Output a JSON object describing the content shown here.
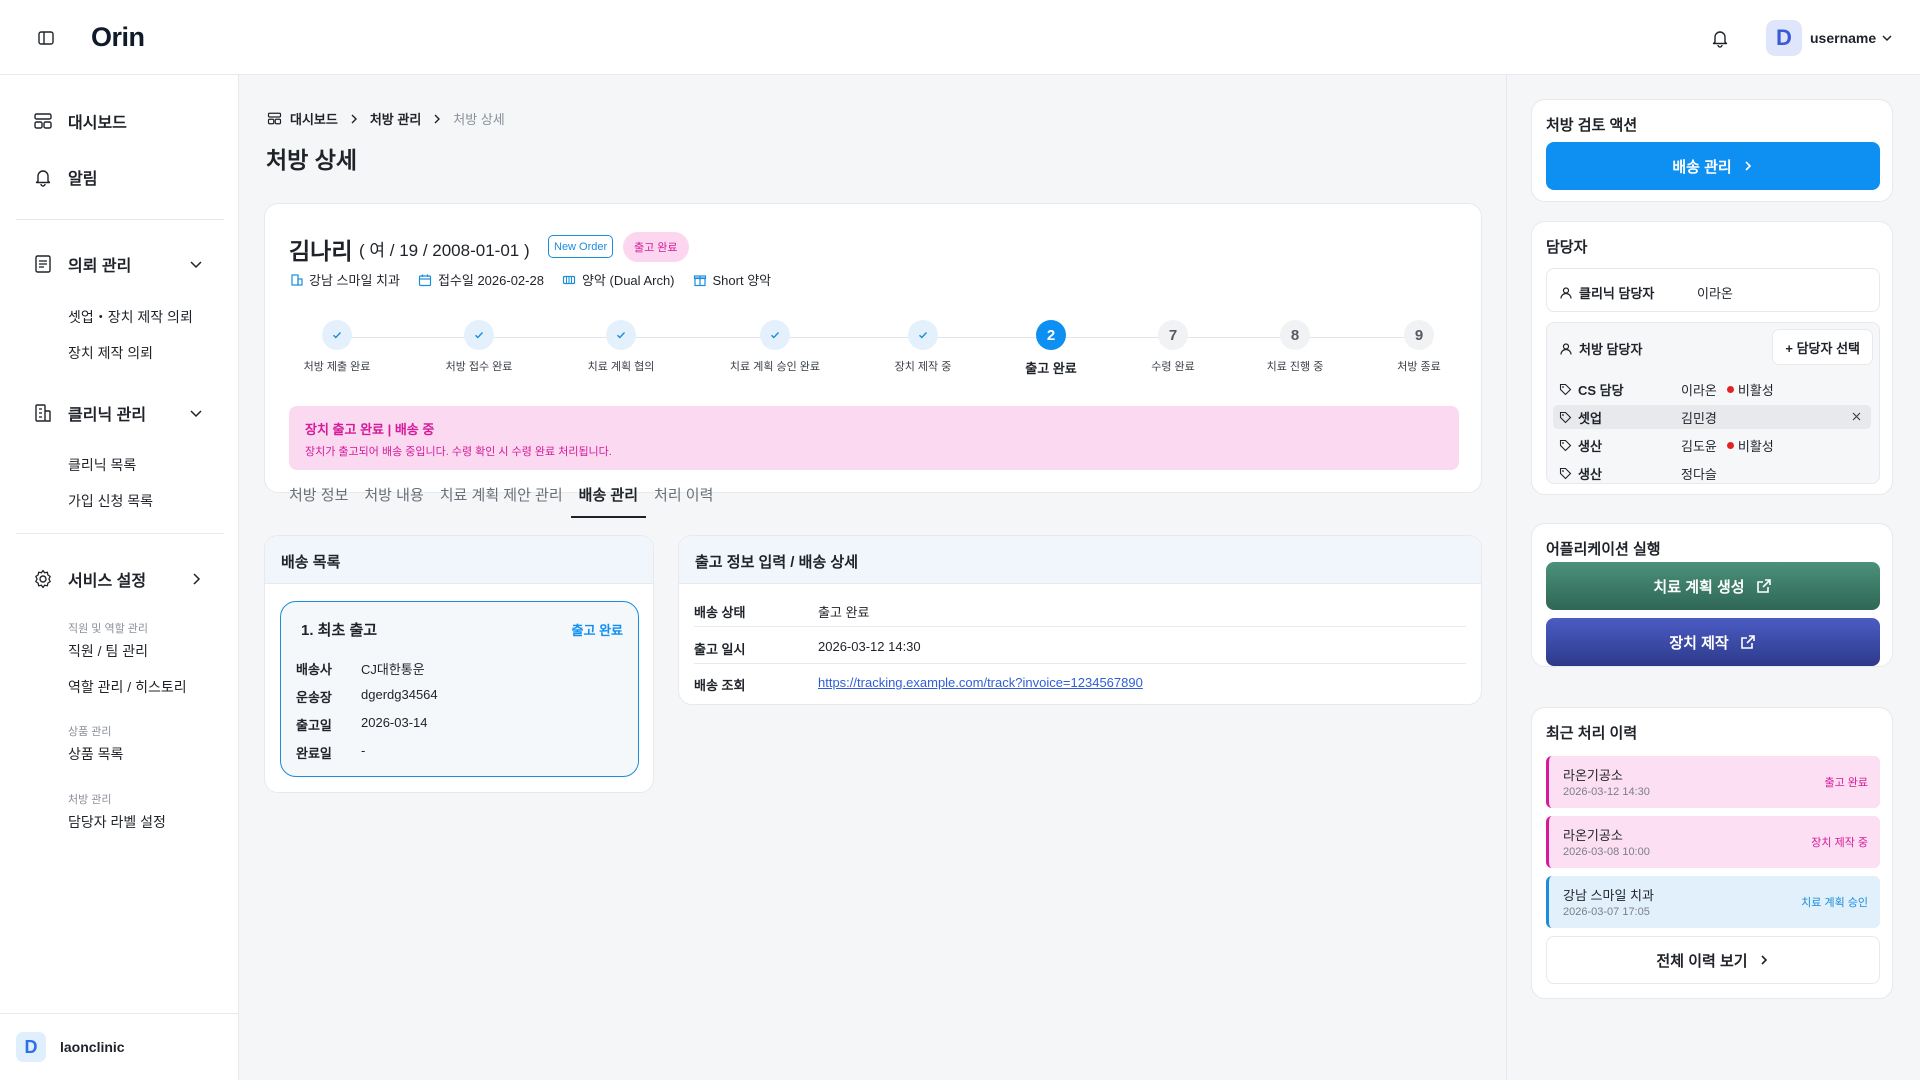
{
  "app": {
    "logo": "Orin",
    "username": "username",
    "avatar_letter": "D"
  },
  "sidebar": {
    "top_items": [
      {
        "label": "대시보드",
        "icon": "dashboard-icon"
      },
      {
        "label": "알림",
        "icon": "bell-icon"
      }
    ],
    "groups": [
      {
        "label": "의뢰 관리",
        "items": [
          "셋업・장치 제작 의뢰",
          "장치 제작 의뢰"
        ]
      },
      {
        "label": "클리닉 관리",
        "items": [
          "클리닉 목록",
          "가입 신청 목록"
        ]
      },
      {
        "label": "서비스 설정",
        "captions": [
          "직원 및 역할 관리",
          "상품 관리",
          "처방 관리"
        ],
        "items": [
          "직원 / 팀 관리",
          "역할 관리 / 히스토리",
          "상품 목록",
          "담당자 라벨 설정"
        ]
      }
    ],
    "footer": {
      "letter": "D",
      "name": "laonclinic"
    }
  },
  "breadcrumb": [
    "대시보드",
    "처방 관리",
    "처방 상세"
  ],
  "page_title": "처방 상세",
  "patient": {
    "name": "김나리",
    "info": "( 여 / 19 / 2008-01-01 )",
    "badge_new": "New Order",
    "badge_status": "출고 완료",
    "clinic": "강남 스마일 치과",
    "received": "접수일 2026-02-28",
    "arch": "양악 (Dual Arch)",
    "plan": "Short 양악"
  },
  "steps": [
    {
      "label": "처방 제출 완료",
      "state": "done"
    },
    {
      "label": "처방 접수 완료",
      "state": "done"
    },
    {
      "label": "치료 계획 협의",
      "state": "done"
    },
    {
      "label": "치료 계획 승인 완료",
      "state": "done"
    },
    {
      "label": "장치 제작 중",
      "state": "done"
    },
    {
      "label": "출고 완료",
      "state": "current",
      "num": "2"
    },
    {
      "label": "수령 완료",
      "state": "todo",
      "num": "7"
    },
    {
      "label": "치료 진행 중",
      "state": "todo",
      "num": "8"
    },
    {
      "label": "처방 종료",
      "state": "todo",
      "num": "9"
    }
  ],
  "alert": {
    "title": "장치 출고 완료 | 배송 중",
    "desc": "장치가 출고되어 배송 중입니다. 수령 확인 시 수령 완료 처리됩니다."
  },
  "tabs": [
    "처방 정보",
    "처방 내용",
    "치료 계획 제안 관리",
    "배송 관리",
    "처리 이력"
  ],
  "active_tab": "배송 관리",
  "shipping_list": {
    "title": "배송 목록",
    "item": {
      "title": "1. 최초 출고",
      "status": "출고 완료",
      "rows": [
        {
          "k": "배송사",
          "v": "CJ대한통운"
        },
        {
          "k": "운송장",
          "v": "dgerdg34564"
        },
        {
          "k": "출고일",
          "v": "2026-03-14"
        },
        {
          "k": "완료일",
          "v": "-"
        }
      ]
    }
  },
  "shipping_detail": {
    "title": "출고 정보 입력 / 배송 상세",
    "rows": [
      {
        "k": "배송 상태",
        "v": "출고 완료"
      },
      {
        "k": "출고 일시",
        "v": "2026-03-12 14:30"
      },
      {
        "k": "배송 조회",
        "v": "https://tracking.example.com/track?invoice=1234567890"
      }
    ]
  },
  "review": {
    "title": "처방 검토 액션",
    "button": "배송 관리"
  },
  "managers": {
    "title": "담당자",
    "clinic_label": "클리닉 담당자",
    "clinic_name": "이라온",
    "rx_label": "처방 담당자",
    "select_button": "+ 담당자 선택",
    "rows": [
      {
        "tag": "CS 담당",
        "name": "이라온",
        "inactive": "비활성"
      },
      {
        "tag": "셋업",
        "name": "김민경",
        "inactive": ""
      },
      {
        "tag": "생산",
        "name": "김도윤",
        "inactive": "비활성"
      },
      {
        "tag": "생산",
        "name": "정다슬",
        "inactive": ""
      }
    ]
  },
  "apps": {
    "title": "어플리케이션 실행",
    "btn1": "치료 계획 생성",
    "btn2": "장치 제작"
  },
  "history": {
    "title": "최근 처리 이력",
    "items": [
      {
        "who": "라온기공소",
        "when": "2026-03-12 14:30",
        "status": "출고 완료"
      },
      {
        "who": "라온기공소",
        "when": "2026-03-08 10:00",
        "status": "장치 제작 중"
      },
      {
        "who": "강남 스마일 치과",
        "when": "2026-03-07 17:05",
        "status": "치료 계획 승인"
      }
    ],
    "view_all": "전체 이력 보기"
  },
  "colors": {
    "accent": "#0e8ff2",
    "pink": "#d51a9a",
    "green_btn": "#3e7f6c",
    "indigo_btn": "#3b4aa8"
  }
}
